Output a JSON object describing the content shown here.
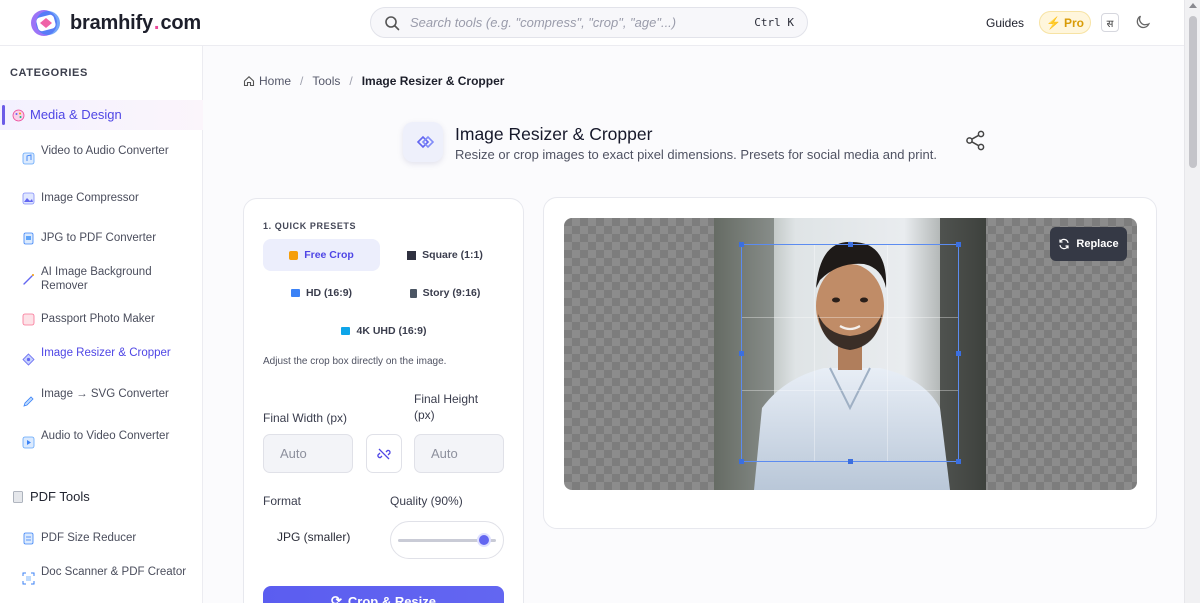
{
  "header": {
    "logo_name": "bramhify",
    "logo_dot": ".",
    "logo_tld": "com",
    "search_placeholder": "Search tools (e.g. \"compress\", \"crop\", \"age\"...)",
    "search_shortcut": "Ctrl K",
    "guides_label": "Guides",
    "pro_label": "Pro",
    "lang_label": "स",
    "colors": {
      "accent": "#4f46e5",
      "pro": "#d89b07",
      "logo_dot": "#ec4899"
    }
  },
  "sidebar": {
    "heading": "CATEGORIES",
    "media_category": "Media & Design",
    "media_items": [
      {
        "label": "Video to Audio Converter",
        "icon": "audio-file-icon"
      },
      {
        "label": "Image Compressor",
        "icon": "image-icon"
      },
      {
        "label": "JPG to PDF Converter",
        "icon": "document-icon"
      },
      {
        "label": "AI Image Background Remover",
        "icon": "magic-wand-icon"
      },
      {
        "label": "Passport Photo Maker",
        "icon": "id-card-icon"
      },
      {
        "label": "Image Resizer & Cropper",
        "icon": "resize-icon",
        "active": true
      },
      {
        "label": "Image → SVG Converter",
        "icon": "pen-icon"
      },
      {
        "label": "Audio to Video Converter",
        "icon": "video-file-icon"
      }
    ],
    "pdf_category": "PDF Tools",
    "pdf_items": [
      {
        "label": "PDF Size Reducer",
        "icon": "pdf-icon"
      },
      {
        "label": "Doc Scanner & PDF Creator",
        "icon": "scanner-icon"
      }
    ]
  },
  "breadcrumb": {
    "home": "Home",
    "tools": "Tools",
    "current": "Image Resizer & Cropper",
    "sep": "/"
  },
  "tool": {
    "title": "Image Resizer & Cropper",
    "description": "Resize or crop images to exact pixel dimensions. Presets for social media and print."
  },
  "settings": {
    "presets_heading": "1. QUICK PRESETS",
    "presets": [
      {
        "label": "Free Crop",
        "icon": "unlock-icon",
        "active": true
      },
      {
        "label": "Square (1:1)",
        "icon": "square-icon"
      },
      {
        "label": "HD (16:9)",
        "icon": "monitor-icon"
      },
      {
        "label": "Story (9:16)",
        "icon": "phone-icon"
      },
      {
        "label": "4K UHD (16:9)",
        "icon": "tv-icon"
      }
    ],
    "hint": "Adjust the crop box directly on the image.",
    "width_label": "Final Width (px)",
    "height_label": "Final Height (px)",
    "width_value": "Auto",
    "height_value": "Auto",
    "format_label": "Format",
    "format_value": "JPG (smaller)",
    "quality_label": "Quality (90%)",
    "quality": 90,
    "crop_button": "Crop & Resize"
  },
  "preview": {
    "replace_label": "Replace"
  }
}
